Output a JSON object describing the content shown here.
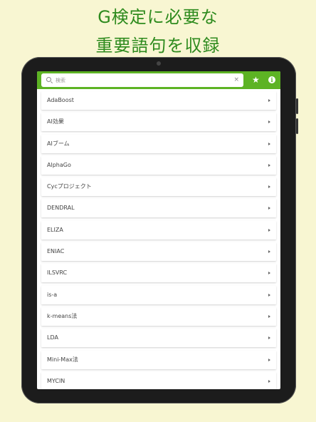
{
  "promo": {
    "line1": "G検定に必要な",
    "line2": "重要語句を収録"
  },
  "search": {
    "placeholder": "検索",
    "clear_glyph": "×"
  },
  "toolbar": {
    "favorite_glyph": "★",
    "info_glyph": "i"
  },
  "colors": {
    "accent": "#5db324",
    "promo_text": "#2e8b1e",
    "background": "#f8f6d2"
  },
  "terms": [
    "AdaBoost",
    "AI効果",
    "AIブーム",
    "AlphaGo",
    "Cycプロジェクト",
    "DENDRAL",
    "ELIZA",
    "ENIAC",
    "ILSVRC",
    "is-a",
    "k-means法",
    "LDA",
    "Mini-Max法",
    "MYCIN"
  ]
}
